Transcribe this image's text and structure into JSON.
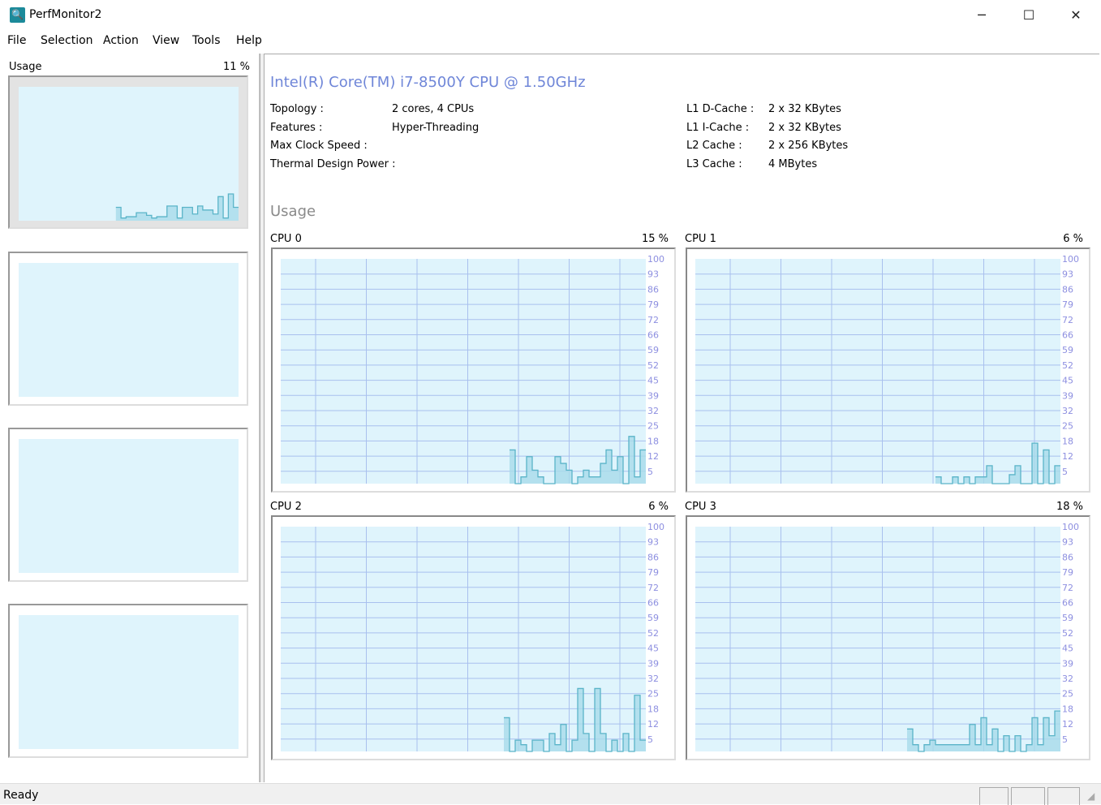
{
  "window": {
    "title": "PerfMonitor2",
    "minimize": "─",
    "maximize": "☐",
    "close": "✕",
    "icon": "perfmonitor-icon"
  },
  "menu": [
    "File",
    "Selection",
    "Action",
    "View",
    "Tools",
    "Help"
  ],
  "sidebar": {
    "tiles": [
      {
        "label": "Usage",
        "value": "11 %",
        "selected": true,
        "values": [
          10,
          2,
          3,
          3,
          6,
          6,
          4,
          2,
          3,
          3,
          11,
          11,
          2,
          10,
          10,
          5,
          11,
          8,
          8,
          5,
          18,
          2,
          20,
          10
        ]
      },
      {
        "label": "",
        "value": "",
        "values": []
      },
      {
        "label": "",
        "value": "",
        "values": []
      },
      {
        "label": "",
        "value": "",
        "values": []
      }
    ]
  },
  "cpu": {
    "name": "Intel(R) Core(TM) i7-8500Y CPU @ 1.50GHz",
    "left_info": [
      {
        "k": "Topology :",
        "v": "2 cores, 4 CPUs"
      },
      {
        "k": "Features :",
        "v": "Hyper-Threading"
      },
      {
        "k": "Max Clock Speed :",
        "v": ""
      },
      {
        "k": "Thermal Design Power :",
        "v": ""
      }
    ],
    "right_info": [
      {
        "k": "L1 D-Cache :",
        "v": "2 x 32 KBytes"
      },
      {
        "k": "L1 I-Cache :",
        "v": "2 x 32 KBytes"
      },
      {
        "k": "L2 Cache :",
        "v": "2 x 256 KBytes"
      },
      {
        "k": "L3 Cache :",
        "v": "4 MBytes"
      }
    ]
  },
  "usage_heading": "Usage",
  "status": {
    "text": "Ready"
  },
  "colors": {
    "plot_bg": "#dff4fc",
    "grid": "#a9c0ee",
    "line": "#5ab4c8",
    "fill": "#a8dbea",
    "title": "#6f86d8",
    "tick": "#8d8fe0"
  },
  "chart_data": [
    {
      "type": "area",
      "title": "CPU 0",
      "value_label": "15 %",
      "ylim": [
        0,
        100
      ],
      "y_ticks": [
        "100",
        "93",
        "86",
        "79",
        "72",
        "66",
        "59",
        "52",
        "45",
        "39",
        "32",
        "25",
        "18",
        "12",
        "5"
      ],
      "grid": true,
      "values": [
        15,
        0,
        3,
        12,
        6,
        3,
        0,
        0,
        12,
        9,
        6,
        0,
        3,
        6,
        3,
        3,
        9,
        15,
        6,
        12,
        0,
        21,
        3,
        15
      ]
    },
    {
      "type": "area",
      "title": "CPU 1",
      "value_label": "6 %",
      "ylim": [
        0,
        100
      ],
      "y_ticks": [
        "100",
        "93",
        "86",
        "79",
        "72",
        "66",
        "59",
        "52",
        "45",
        "39",
        "32",
        "25",
        "18",
        "12",
        "5"
      ],
      "grid": true,
      "values": [
        3,
        0,
        0,
        3,
        0,
        3,
        0,
        3,
        3,
        8,
        0,
        0,
        0,
        4,
        8,
        0,
        0,
        18,
        0,
        15,
        0,
        8
      ]
    },
    {
      "type": "area",
      "title": "CPU 2",
      "value_label": "6 %",
      "ylim": [
        0,
        100
      ],
      "y_ticks": [
        "100",
        "93",
        "86",
        "79",
        "72",
        "66",
        "59",
        "52",
        "45",
        "39",
        "32",
        "25",
        "18",
        "12",
        "5"
      ],
      "grid": true,
      "values": [
        15,
        0,
        5,
        3,
        0,
        5,
        5,
        0,
        8,
        3,
        12,
        0,
        5,
        28,
        8,
        0,
        28,
        8,
        0,
        5,
        0,
        8,
        0,
        25,
        5
      ]
    },
    {
      "type": "area",
      "title": "CPU 3",
      "value_label": "18 %",
      "ylim": [
        0,
        100
      ],
      "y_ticks": [
        "100",
        "93",
        "86",
        "79",
        "72",
        "66",
        "59",
        "52",
        "45",
        "39",
        "32",
        "25",
        "18",
        "12",
        "5"
      ],
      "grid": true,
      "values": [
        10,
        3,
        0,
        3,
        5,
        3,
        3,
        3,
        3,
        3,
        3,
        12,
        3,
        15,
        3,
        10,
        0,
        7,
        0,
        7,
        0,
        3,
        15,
        3,
        15,
        7,
        18
      ]
    }
  ]
}
